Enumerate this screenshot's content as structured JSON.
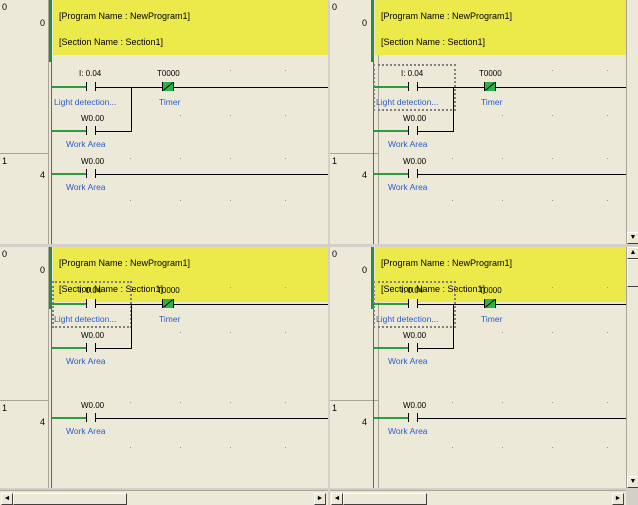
{
  "header": {
    "program_line": "[Program Name : NewProgram1]",
    "section_line": "[Section Name : Section1]"
  },
  "rungs": [
    {
      "number": "0",
      "step": "0"
    },
    {
      "number": "1",
      "step": "4"
    }
  ],
  "contacts": {
    "input": {
      "address": "I: 0.04",
      "comment": "Light detection..."
    },
    "work": {
      "address": "W0.00",
      "comment": "Work Area"
    },
    "timer": {
      "address": "T0000",
      "comment": "Timer"
    }
  },
  "scroll": {
    "up_glyph": "▲",
    "down_glyph": "▼",
    "left_glyph": "◄",
    "right_glyph": "►"
  },
  "colors": {
    "header_bg": "#ecea4a",
    "rail": "#2e8b3a",
    "comment_text": "#2a5cc8",
    "coil": "#2db24a"
  }
}
